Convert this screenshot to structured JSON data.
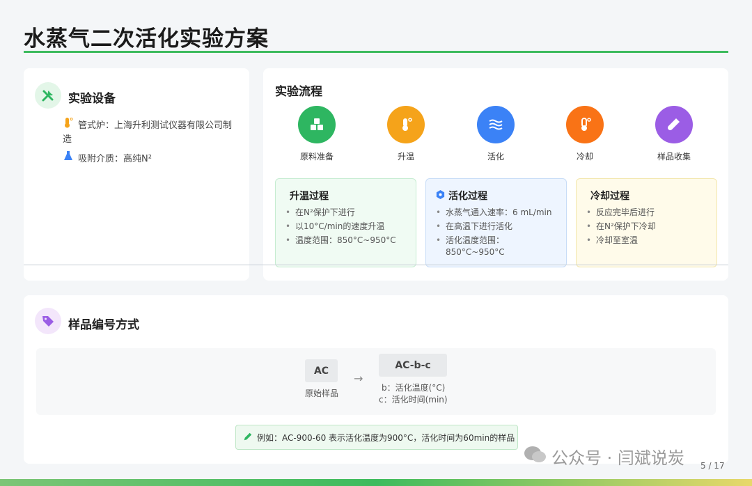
{
  "page": {
    "title": "水蒸气二次活化实验方案",
    "page_number": "5 / 17",
    "watermark": "公众号 · 闫斌说炭"
  },
  "equipment": {
    "heading": "实验设备",
    "items": [
      {
        "icon": "thermometer-icon",
        "text": "管式炉：上海升利测试仪器有限公司制造"
      },
      {
        "icon": "flask-icon",
        "text": "吸附介质：高纯N²"
      }
    ]
  },
  "flow": {
    "heading": "实验流程",
    "steps": [
      {
        "label": "原料准备",
        "color": "#2eb661",
        "icon": "cubes-icon"
      },
      {
        "label": "升温",
        "color": "#f5a31a",
        "icon": "thermometer-icon"
      },
      {
        "label": "活化",
        "color": "#3b82f6",
        "icon": "water-icon"
      },
      {
        "label": "冷却",
        "color": "#f97316",
        "icon": "thermometer-low-icon"
      },
      {
        "label": "样品收集",
        "color": "#9b5de5",
        "icon": "test-tube-icon"
      }
    ],
    "processes": [
      {
        "title": "升温过程",
        "items": [
          "在N²保护下进行",
          "以10°C/min的速度升温",
          "温度范围：850°C~950°C"
        ]
      },
      {
        "title": "活化过程",
        "items": [
          "水蒸气通入速率：6 mL/min",
          "在高温下进行活化",
          "活化温度范围：850°C~950°C"
        ]
      },
      {
        "title": "冷却过程",
        "items": [
          "反应完毕后进行",
          "在N²保护下冷却",
          "冷却至室温"
        ]
      }
    ]
  },
  "sample": {
    "heading": "样品编号方式",
    "original_code": "AC",
    "original_label": "原始样品",
    "arrow": "→",
    "new_code": "AC-b-c",
    "desc_b": "b：活化温度(°C)",
    "desc_c": "c：活化时间(min)",
    "example": "例如：AC-900-60 表示活化温度为900°C，活化时间为60min的样品"
  },
  "colors": {
    "accent_green": "#3dbb5e",
    "heat_box_bg": "#f0fbf3",
    "activate_box_bg": "#eef5ff",
    "cool_box_bg": "#fffbea"
  }
}
